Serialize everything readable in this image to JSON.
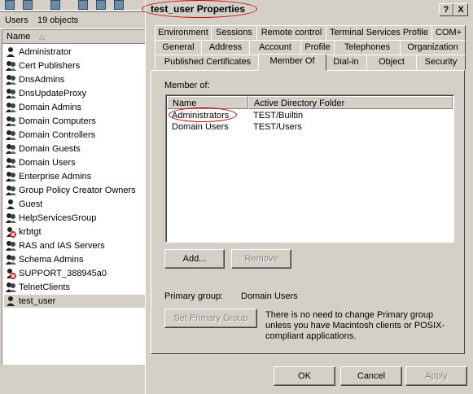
{
  "left_pane": {
    "status": {
      "type": "Users",
      "count": "19 objects"
    },
    "column_header": "Name",
    "sort_indicator": "△",
    "items": [
      {
        "label": "Administrator",
        "icon": "user-icon"
      },
      {
        "label": "Cert Publishers",
        "icon": "group-icon"
      },
      {
        "label": "DnsAdmins",
        "icon": "group-icon"
      },
      {
        "label": "DnsUpdateProxy",
        "icon": "group-icon"
      },
      {
        "label": "Domain Admins",
        "icon": "group-icon"
      },
      {
        "label": "Domain Computers",
        "icon": "group-icon"
      },
      {
        "label": "Domain Controllers",
        "icon": "group-icon"
      },
      {
        "label": "Domain Guests",
        "icon": "group-icon"
      },
      {
        "label": "Domain Users",
        "icon": "group-icon"
      },
      {
        "label": "Enterprise Admins",
        "icon": "group-icon"
      },
      {
        "label": "Group Policy Creator Owners",
        "icon": "group-icon"
      },
      {
        "label": "Guest",
        "icon": "user-icon"
      },
      {
        "label": "HelpServicesGroup",
        "icon": "group-icon"
      },
      {
        "label": "krbtgt",
        "icon": "disabled-user-icon"
      },
      {
        "label": "RAS and IAS Servers",
        "icon": "group-icon"
      },
      {
        "label": "Schema Admins",
        "icon": "group-icon"
      },
      {
        "label": "SUPPORT_388945a0",
        "icon": "disabled-user-icon"
      },
      {
        "label": "TelnetClients",
        "icon": "group-icon"
      },
      {
        "label": "test_user",
        "icon": "user-icon"
      }
    ],
    "selected_index": 18
  },
  "dialog": {
    "title": "test_user Properties",
    "help_btn": "?",
    "close_btn": "X",
    "tabs_row1": [
      "Environment",
      "Sessions",
      "Remote control",
      "Terminal Services Profile",
      "COM+"
    ],
    "tabs_row2": [
      "General",
      "Address",
      "Account",
      "Profile",
      "Telephones",
      "Organization"
    ],
    "tabs_row3": [
      "Published Certificates",
      "Member Of",
      "Dial-in",
      "Object",
      "Security"
    ],
    "active_tab": "Member Of",
    "member_of_label": "Member of:",
    "columns": [
      "Name",
      "Active Directory Folder"
    ],
    "rows": [
      {
        "name": "Administrators",
        "folder": "TEST/Builtin"
      },
      {
        "name": "Domain Users",
        "folder": "TEST/Users"
      }
    ],
    "add_btn": "Add...",
    "remove_btn": "Remove",
    "primary_group_label": "Primary group:",
    "primary_group_value": "Domain Users",
    "set_primary_btn": "Set Primary Group",
    "info_text": "There is no need to change Primary group unless you have Macintosh clients or POSIX-compliant applications.",
    "ok_btn": "OK",
    "cancel_btn": "Cancel",
    "apply_btn": "Apply"
  },
  "colors": {
    "annotation": "#cc0000",
    "face": "#d4d0c8"
  }
}
